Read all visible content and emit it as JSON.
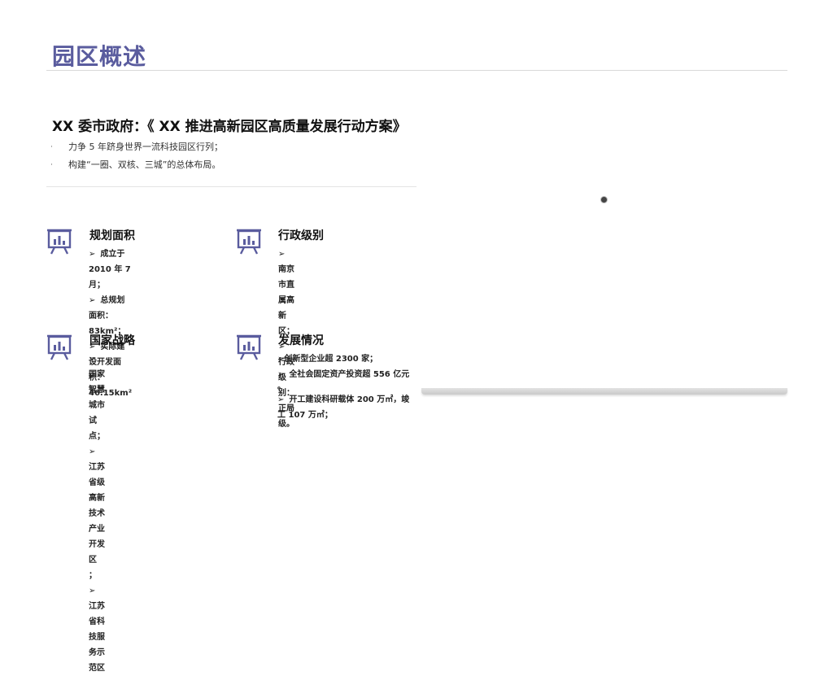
{
  "page": {
    "title": "园区概述"
  },
  "intro": {
    "headline": "XX 委市政府：《 XX 推进高新园区高质量发展行动方案》",
    "bullet_symbol": "·",
    "bullets": [
      "力争 5 年跻身世界一流科技园区行列；",
      "构建“一圈、双核、三城”的总体布局。"
    ]
  },
  "sections": [
    {
      "title": "规划面积",
      "icon": "presentation-chart-icon",
      "items": [
        "成立于 2010 年 7 月；",
        "总规划面积：  83km²；",
        "实际建设开发面积：  46.15km²"
      ]
    },
    {
      "title": "行政级别",
      "icon": "presentation-chart-icon",
      "items": [
        "南京市直属高新区；",
        "行政级别：正局级。"
      ]
    },
    {
      "title": "国家战略",
      "icon": "presentation-chart-icon",
      "items": [
        "国家智慧城市试点；",
        "江苏省级高新技术产业开发区",
        "；",
        "江苏省科技服务示范区"
      ]
    },
    {
      "title": "发展情况",
      "icon": "presentation-chart-icon",
      "items": [
        "创新型企业超 2300 家；",
        "全社会固定资产投资超 556 亿元",
        "。",
        "开工建设科研载体 200 万㎡，竣",
        "工 107 万㎡；"
      ]
    }
  ],
  "colors": {
    "accent": "#5a5c9e",
    "rule": "#d9d9d9"
  }
}
